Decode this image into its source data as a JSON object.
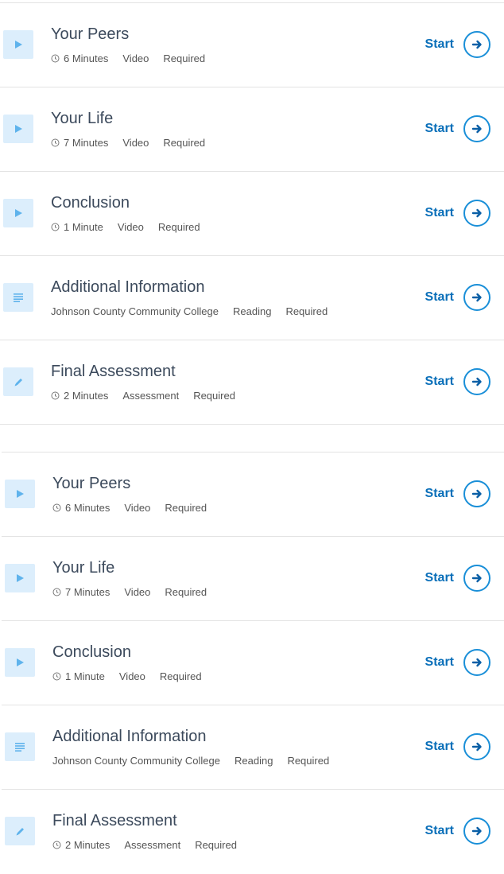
{
  "colors": {
    "accent": "#1a8fd8",
    "start_text": "#0a6fb9",
    "icon_bg": "#dceefc",
    "icon_fg": "#5fb3ec",
    "title": "#3c4a5c",
    "divider": "#e3e3e3"
  },
  "lists": [
    {
      "items": [
        {
          "icon": "play-icon",
          "title": "Your Peers",
          "duration": "6 Minutes",
          "kind": "Video",
          "status": "Required",
          "action": "Start"
        },
        {
          "icon": "play-icon",
          "title": "Your Life",
          "duration": "7 Minutes",
          "kind": "Video",
          "status": "Required",
          "action": "Start"
        },
        {
          "icon": "play-icon",
          "title": "Conclusion",
          "duration": "1 Minute",
          "kind": "Video",
          "status": "Required",
          "action": "Start"
        },
        {
          "icon": "document-icon",
          "title": "Additional Information",
          "source": "Johnson County Community College",
          "kind": "Reading",
          "status": "Required",
          "action": "Start"
        },
        {
          "icon": "pencil-icon",
          "title": "Final Assessment",
          "duration": "2 Minutes",
          "kind": "Assessment",
          "status": "Required",
          "action": "Start"
        }
      ]
    },
    {
      "items": [
        {
          "icon": "play-icon",
          "title": "Your Peers",
          "duration": "6 Minutes",
          "kind": "Video",
          "status": "Required",
          "action": "Start"
        },
        {
          "icon": "play-icon",
          "title": "Your Life",
          "duration": "7 Minutes",
          "kind": "Video",
          "status": "Required",
          "action": "Start"
        },
        {
          "icon": "play-icon",
          "title": "Conclusion",
          "duration": "1 Minute",
          "kind": "Video",
          "status": "Required",
          "action": "Start"
        },
        {
          "icon": "document-icon",
          "title": "Additional Information",
          "source": "Johnson County Community College",
          "kind": "Reading",
          "status": "Required",
          "action": "Start"
        },
        {
          "icon": "pencil-icon",
          "title": "Final Assessment",
          "duration": "2 Minutes",
          "kind": "Assessment",
          "status": "Required",
          "action": "Start"
        }
      ]
    }
  ]
}
